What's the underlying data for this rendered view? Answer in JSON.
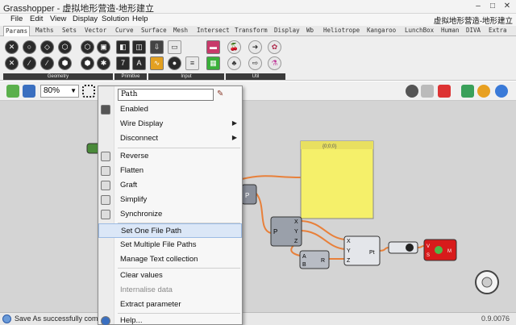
{
  "window": {
    "title": "Grasshopper - 虚拟地形营造-地形建立"
  },
  "menubar": {
    "items": [
      "File",
      "Edit",
      "View",
      "Display",
      "Solution",
      "Help"
    ],
    "document": "虚拟地形营造-地形建立"
  },
  "tabs": [
    "Params",
    "Maths",
    "Sets",
    "Vector",
    "Curve",
    "Surface",
    "Mesh",
    "Intersect",
    "Transform",
    "Display",
    "Wb",
    "Heliotrope",
    "Kangaroo",
    "LunchBox",
    "Human",
    "DIVA",
    "Extra"
  ],
  "ribbon_groups": [
    "Geometry",
    "Primitive",
    "Input",
    "Util"
  ],
  "toolbar": {
    "zoom": "80%"
  },
  "context_menu": {
    "name_value": "Path",
    "items": [
      {
        "label": "Enabled",
        "icon": "checkbox-icon"
      },
      {
        "label": "Wire Display",
        "submenu": true
      },
      {
        "label": "Disconnect",
        "submenu": true
      },
      {
        "label": "Reverse",
        "icon": "reverse-icon"
      },
      {
        "label": "Flatten",
        "icon": "flatten-icon"
      },
      {
        "label": "Graft",
        "icon": "graft-icon"
      },
      {
        "label": "Simplify",
        "icon": "simplify-icon"
      },
      {
        "label": "Synchronize",
        "icon": "synchronize-icon"
      },
      {
        "label": "Set One File Path",
        "highlighted": true
      },
      {
        "label": "Set Multiple File Paths"
      },
      {
        "label": "Manage Text collection"
      },
      {
        "label": "Clear values"
      },
      {
        "label": "Internalise data",
        "disabled": true
      },
      {
        "label": "Extract parameter"
      },
      {
        "label": "Help...",
        "icon": "help-icon"
      }
    ]
  },
  "canvas": {
    "panel_header": "{0;0;0}",
    "node_labels": {
      "param": "P",
      "decompose_in": "P",
      "decompose_out": [
        "X",
        "Y",
        "Z"
      ],
      "construct_in": [
        "X",
        "Y",
        "Z"
      ],
      "construct_out": "Pt",
      "multiply_in": [
        "A",
        "B"
      ],
      "multiply_out": "R",
      "mesh_in": [
        "V",
        "S"
      ],
      "mesh_out": "M"
    }
  },
  "status": {
    "message": "Save As successfully completed",
    "version": "0.9.0076"
  },
  "colors": {
    "panel": "#f5f06a",
    "wire": "#e8803a",
    "mesh_node": "#d81b1b"
  }
}
